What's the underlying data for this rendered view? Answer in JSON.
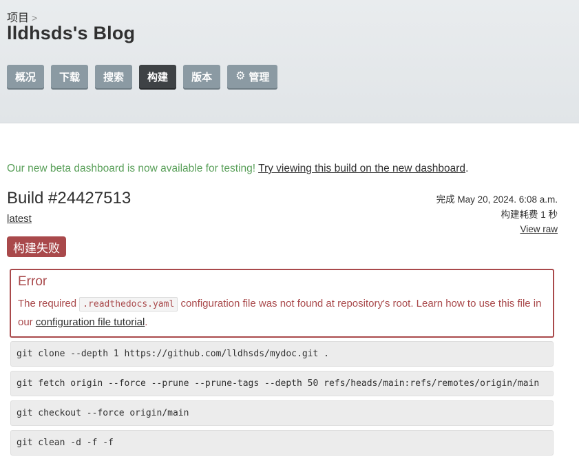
{
  "header": {
    "breadcrumb": "项目",
    "breadcrumb_sep": ">",
    "project_title": "lldhsds's Blog",
    "tabs": [
      {
        "label": "概况",
        "active": false
      },
      {
        "label": "下载",
        "active": false
      },
      {
        "label": "搜索",
        "active": false
      },
      {
        "label": "构建",
        "active": true
      },
      {
        "label": "版本",
        "active": false
      },
      {
        "label": "管理",
        "active": false,
        "icon": "gear-icon"
      }
    ]
  },
  "beta_notice": {
    "text": "Our new beta dashboard is now available for testing!",
    "link": "Try viewing this build on the new dashboard",
    "end": "."
  },
  "build": {
    "title": "Build #24427513",
    "version": "latest",
    "finished": "完成 May 20, 2024. 6:08 a.m.",
    "duration": "构建耗费 1 秒",
    "view_raw": "View raw",
    "status": "构建失败"
  },
  "error": {
    "title": "Error",
    "text_before": "The required",
    "code": ".readthedocs.yaml",
    "text_after": "configuration file was not found at repository's root. Learn how to use this file in our",
    "link": "configuration file tutorial",
    "end": "."
  },
  "commands": [
    "git clone --depth 1 https://github.com/lldhsds/mydoc.git .",
    "git fetch origin --force --prune --prune-tags --depth 50 refs/heads/main:refs/remotes/origin/main",
    "git checkout --force origin/main",
    "git clean -d -f -f"
  ],
  "colors": {
    "header_bg": "#e5e8eb",
    "tab_bg": "#8b9aa3",
    "tab_active_bg": "#3e4245",
    "success_green": "#5aa05a",
    "error_red": "#a9494b"
  }
}
